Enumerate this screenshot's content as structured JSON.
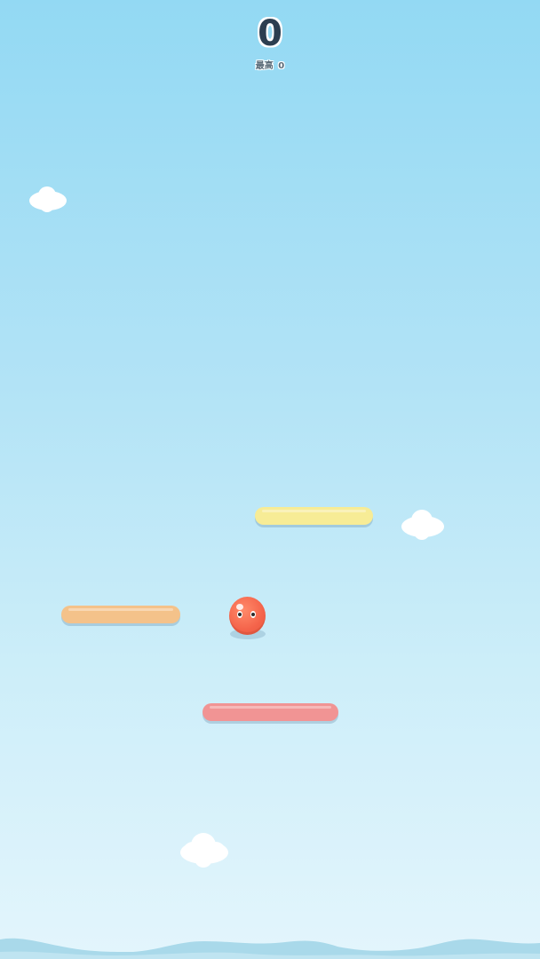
{
  "game": {
    "score": "0",
    "best_label": "最高",
    "best_value": "0"
  },
  "colors": {
    "sky_top": "#93d9f3",
    "sky_bottom": "#e3f5fc",
    "platform_yellow": "#f7ec96",
    "platform_orange": "#f4c28a",
    "platform_pink": "#f19494",
    "ball": "#f4634a",
    "cloud": "#ffffff",
    "hills": "#a9d9ea"
  },
  "icons": {
    "player": "ball-character-icon",
    "cloud": "cloud-icon"
  }
}
